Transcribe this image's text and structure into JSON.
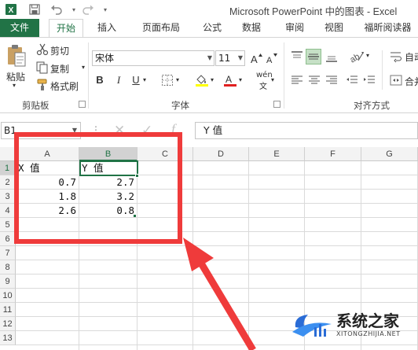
{
  "window": {
    "title": "Microsoft PowerPoint 中的图表 - Excel",
    "quick_access": [
      "excel-logo-icon",
      "save-icon",
      "undo-icon",
      "redo-icon"
    ]
  },
  "tabs": [
    {
      "label": "文件",
      "kind": "file"
    },
    {
      "label": "开始",
      "kind": "active"
    },
    {
      "label": "插入",
      "kind": "normal"
    },
    {
      "label": "页面布局",
      "kind": "normal"
    },
    {
      "label": "公式",
      "kind": "normal"
    },
    {
      "label": "数据",
      "kind": "normal"
    },
    {
      "label": "审阅",
      "kind": "normal"
    },
    {
      "label": "视图",
      "kind": "normal"
    },
    {
      "label": "福昕阅读器",
      "kind": "normal"
    }
  ],
  "ribbon": {
    "clipboard": {
      "paste_label": "粘贴",
      "cut_label": "剪切",
      "copy_label": "复制",
      "format_painter_label": "格式刷",
      "group_label": "剪贴板"
    },
    "font": {
      "font_name": "宋体",
      "font_size": "11",
      "bold": "B",
      "italic": "I",
      "underline": "U",
      "phonetic": "wén",
      "group_label": "字体"
    },
    "alignment": {
      "wrap_label": "自动",
      "merge_label": "合并",
      "group_label": "对齐方式"
    }
  },
  "formula_bar": {
    "name_box": "B1",
    "cancel": "✕",
    "enter": "✓",
    "fx": "f",
    "content": "Y 值"
  },
  "grid": {
    "columns": [
      "A",
      "B",
      "C",
      "D",
      "E",
      "F",
      "G"
    ],
    "selected_column": "B",
    "rows": [
      "1",
      "2",
      "3",
      "4",
      "5",
      "6",
      "7",
      "8",
      "9",
      "10",
      "11",
      "12",
      "13"
    ],
    "selected_row": "1",
    "cells": [
      [
        {
          "v": "X 值",
          "t": "txt"
        },
        {
          "v": "Y 值",
          "t": "txt"
        }
      ],
      [
        {
          "v": "0.7",
          "t": "num"
        },
        {
          "v": "2.7",
          "t": "num"
        }
      ],
      [
        {
          "v": "1.8",
          "t": "num"
        },
        {
          "v": "3.2",
          "t": "num"
        }
      ],
      [
        {
          "v": "2.6",
          "t": "num"
        },
        {
          "v": "0.8",
          "t": "num"
        }
      ]
    ]
  },
  "watermark": {
    "brand": "系统之家",
    "url": "XITONGZHIJIA.NET"
  },
  "colors": {
    "excel_green": "#217346",
    "annotation_red": "#ef3b3b"
  }
}
